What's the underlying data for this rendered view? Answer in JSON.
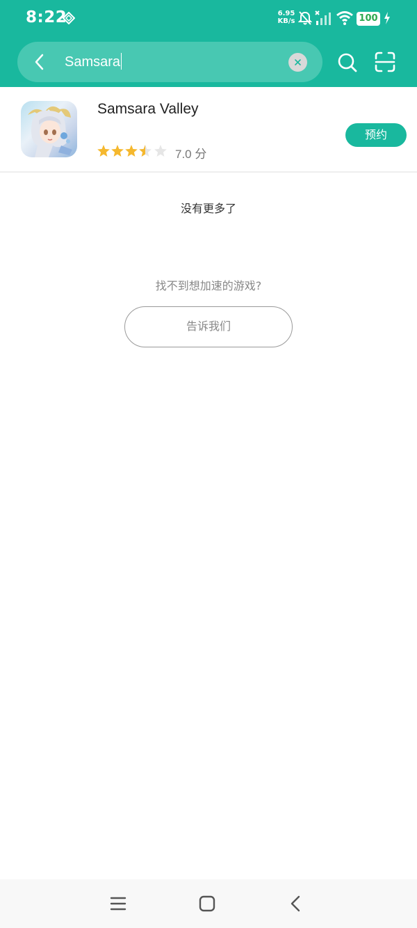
{
  "status_bar": {
    "time": "8:22",
    "net_speed_value": "6.95",
    "net_speed_unit": "KB/s",
    "battery": "100",
    "icons": [
      "location-diamond-icon",
      "mute-icon",
      "signal-icon",
      "wifi-icon",
      "battery-icon",
      "charging-icon"
    ]
  },
  "search": {
    "query": "Samsara",
    "icons": [
      "back-arrow-icon",
      "clear-icon",
      "search-icon",
      "scan-icon"
    ]
  },
  "result": {
    "name": "Samsara Valley",
    "rating_text": "7.0 分",
    "rating_stars": 3.5,
    "rating_max": 5,
    "action_label": "预约"
  },
  "list_end_text": "没有更多了",
  "not_found": {
    "prompt": "找不到想加速的游戏?",
    "button_label": "告诉我们"
  },
  "nav": {
    "icons": [
      "menu-icon",
      "home-icon",
      "back-icon"
    ]
  },
  "colors": {
    "accent": "#19b89e",
    "star": "#f5b82e",
    "star_empty": "#e6e6e6"
  }
}
